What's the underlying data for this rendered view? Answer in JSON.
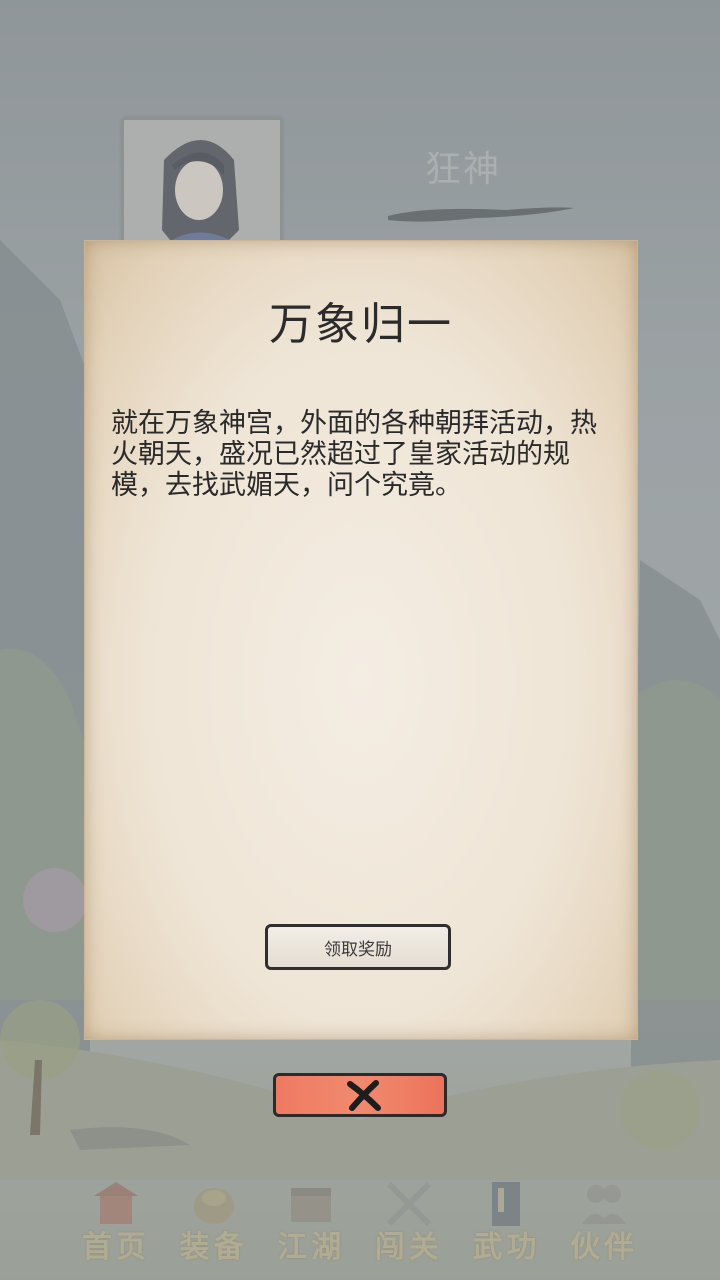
{
  "hero": {
    "name": "狂神"
  },
  "dialog": {
    "title": "万象归一",
    "body": "就在万象神宫，外面的各种朝拜活动，热火朝天，盛况已然超过了皇家活动的规模，去找武媚天，问个究竟。",
    "claim_label": "领取奖励"
  },
  "close_button": {
    "icon": "close-icon"
  },
  "nav": {
    "items": [
      {
        "label": "首页",
        "icon": "home-icon"
      },
      {
        "label": "装备",
        "icon": "equipment-icon"
      },
      {
        "label": "江湖",
        "icon": "jianghu-icon"
      },
      {
        "label": "闯关",
        "icon": "battle-icon"
      },
      {
        "label": "武功",
        "icon": "martial-arts-icon"
      },
      {
        "label": "伙伴",
        "icon": "partners-icon"
      }
    ]
  },
  "colors": {
    "close_accent": "#ef7a62",
    "paper": "#efe5d6",
    "nav_label": "#c7b88d"
  }
}
